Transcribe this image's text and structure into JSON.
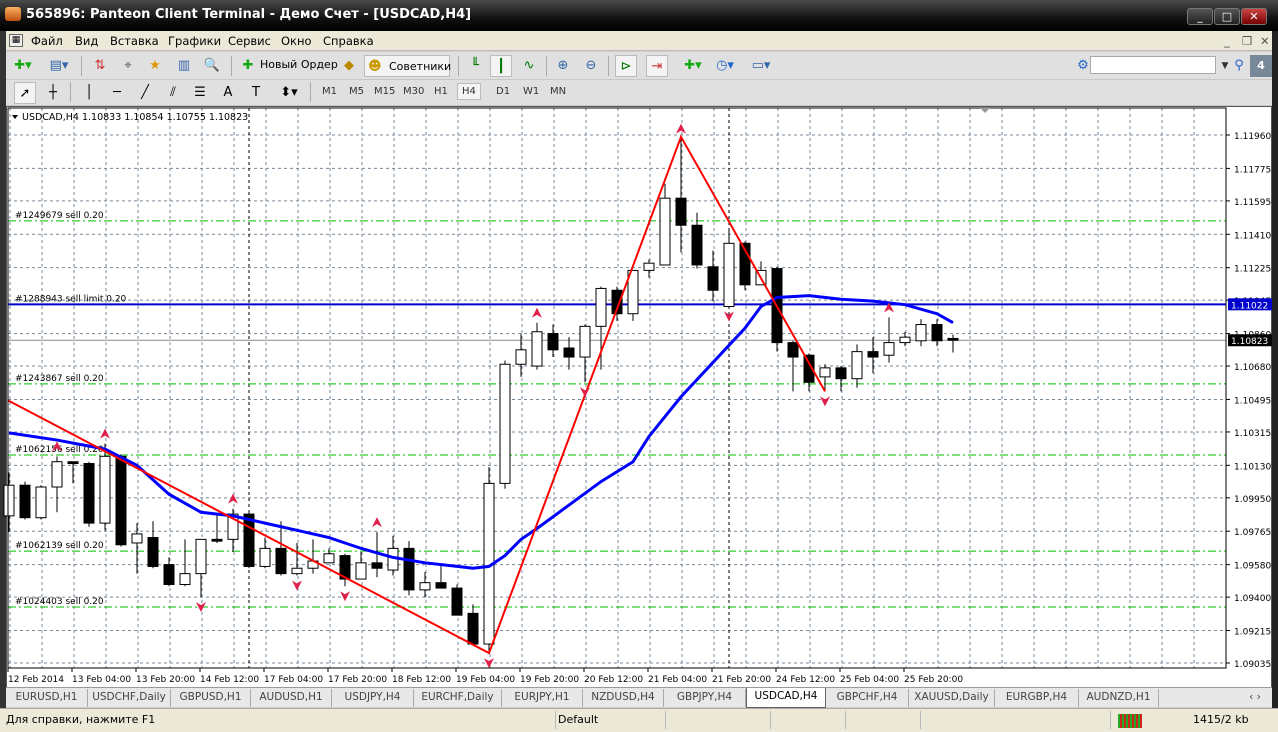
{
  "window": {
    "title": "565896: Panteon Client Terminal - Демо Счет - [USDCAD,H4]",
    "min": "_",
    "max": "□",
    "close": "✕"
  },
  "menu": [
    "Файл",
    "Вид",
    "Вставка",
    "Графики",
    "Сервис",
    "Окно",
    "Справка"
  ],
  "toolbar": {
    "new_order": "Новый Ордер",
    "experts": "Советники",
    "notifications": "4",
    "search_value": ""
  },
  "timeframes": [
    "M1",
    "M5",
    "M15",
    "M30",
    "H1",
    "H4",
    "D1",
    "W1",
    "MN"
  ],
  "active_timeframe": "H4",
  "chart": {
    "header": "USDCAD,H4  1.10833 1.10854 1.10755 1.10823",
    "current_price": "1.10823",
    "pending_price": "1.11022",
    "colors": {
      "ma": "#0000ff",
      "zigzag": "#ff0000",
      "orders": "#00c000",
      "pending": "#0000cc",
      "arrows": "#e0204a"
    },
    "price_ticks": [
      "1.11960",
      "1.11775",
      "1.11595",
      "1.11410",
      "1.11225",
      "1.11045",
      "1.10860",
      "1.10680",
      "1.10495",
      "1.10315",
      "1.10130",
      "1.09950",
      "1.09765",
      "1.09580",
      "1.09400",
      "1.09215",
      "1.09035"
    ],
    "time_labels": [
      "12 Feb 2014",
      "13 Feb 04:00",
      "13 Feb 20:00",
      "14 Feb 12:00",
      "17 Feb 04:00",
      "17 Feb 20:00",
      "18 Feb 12:00",
      "19 Feb 04:00",
      "19 Feb 20:00",
      "20 Feb 12:00",
      "21 Feb 04:00",
      "21 Feb 20:00",
      "24 Feb 12:00",
      "25 Feb 04:00",
      "25 Feb 20:00"
    ],
    "orders": [
      {
        "label": "#1249679 sell 0.20",
        "price": 1.11484,
        "type": "sell"
      },
      {
        "label": "#1288943 sell limit 0.20",
        "price": 1.11022,
        "type": "pending"
      },
      {
        "label": "#1243867 sell 0.20",
        "price": 1.10581,
        "type": "sell"
      },
      {
        "label": "#1062156 sell 0.20",
        "price": 1.10187,
        "type": "sell"
      },
      {
        "label": "#1062139 sell 0.20",
        "price": 1.09655,
        "type": "sell"
      },
      {
        "label": "#1024403 sell 0.20",
        "price": 1.09345,
        "type": "sell"
      }
    ]
  },
  "chart_data": {
    "type": "candlestick",
    "symbol": "USDCAD",
    "timeframe": "H4",
    "ylim": [
      1.09035,
      1.1196
    ],
    "ohlc": [
      [
        1.0985,
        1.1009,
        1.0976,
        1.1002
      ],
      [
        1.1002,
        1.1004,
        1.0983,
        1.0984
      ],
      [
        1.0984,
        1.1002,
        1.0983,
        1.1001
      ],
      [
        1.1001,
        1.1018,
        1.0987,
        1.1015
      ],
      [
        1.1015,
        1.1015,
        1.1003,
        1.1014
      ],
      [
        1.1014,
        1.1015,
        1.0979,
        1.0981
      ],
      [
        1.0981,
        1.1025,
        1.0977,
        1.1018
      ],
      [
        1.1018,
        1.1019,
        1.0968,
        1.0969
      ],
      [
        1.097,
        1.0981,
        1.0953,
        1.0975
      ],
      [
        1.0973,
        1.0982,
        1.0956,
        1.0957
      ],
      [
        1.0958,
        1.0962,
        1.0946,
        1.0947
      ],
      [
        1.0947,
        1.0972,
        1.0946,
        1.0953
      ],
      [
        1.0953,
        1.0972,
        1.094,
        1.0972
      ],
      [
        1.0972,
        1.0986,
        1.097,
        1.0971
      ],
      [
        1.0972,
        1.0989,
        1.0965,
        1.0986
      ],
      [
        1.0986,
        1.0988,
        1.0956,
        1.0957
      ],
      [
        1.0957,
        1.0973,
        1.0956,
        1.0967
      ],
      [
        1.0967,
        1.0982,
        1.0952,
        1.0953
      ],
      [
        1.0953,
        1.097,
        1.0952,
        1.0956
      ],
      [
        1.0956,
        1.0972,
        1.0953,
        1.096
      ],
      [
        1.0959,
        1.0967,
        1.0959,
        1.0964
      ],
      [
        1.0963,
        1.0964,
        1.0946,
        1.095
      ],
      [
        1.095,
        1.0965,
        1.095,
        1.0959
      ],
      [
        1.0959,
        1.0976,
        1.0951,
        1.0956
      ],
      [
        1.0955,
        1.0974,
        1.0952,
        1.0967
      ],
      [
        1.0967,
        1.0971,
        1.0941,
        1.0944
      ],
      [
        1.0944,
        1.0954,
        1.094,
        1.0948
      ],
      [
        1.0948,
        1.0958,
        1.0945,
        1.0945
      ],
      [
        1.0945,
        1.0947,
        1.093,
        1.093
      ],
      [
        1.0931,
        1.0936,
        1.0914,
        1.0914
      ],
      [
        1.0914,
        1.1012,
        1.0909,
        1.1003
      ],
      [
        1.1003,
        1.1071,
        1.1,
        1.1069
      ],
      [
        1.1069,
        1.1086,
        1.1062,
        1.1077
      ],
      [
        1.1068,
        1.1092,
        1.1066,
        1.1087
      ],
      [
        1.1086,
        1.1091,
        1.1073,
        1.1077
      ],
      [
        1.1078,
        1.1084,
        1.1066,
        1.1073
      ],
      [
        1.1073,
        1.1091,
        1.1059,
        1.109
      ],
      [
        1.109,
        1.1112,
        1.1066,
        1.1111
      ],
      [
        1.111,
        1.1112,
        1.1093,
        1.1097
      ],
      [
        1.1097,
        1.1121,
        1.1093,
        1.1121
      ],
      [
        1.1121,
        1.1127,
        1.1117,
        1.1125
      ],
      [
        1.1124,
        1.1169,
        1.1124,
        1.1161
      ],
      [
        1.1161,
        1.1194,
        1.1131,
        1.1146
      ],
      [
        1.1146,
        1.1153,
        1.1122,
        1.1124
      ],
      [
        1.1123,
        1.1132,
        1.1104,
        1.111
      ],
      [
        1.1101,
        1.1144,
        1.1101,
        1.1136
      ],
      [
        1.1136,
        1.1137,
        1.111,
        1.1113
      ],
      [
        1.1113,
        1.1126,
        1.1113,
        1.1121
      ],
      [
        1.1122,
        1.1123,
        1.1076,
        1.1081
      ],
      [
        1.1081,
        1.1082,
        1.1054,
        1.1073
      ],
      [
        1.1074,
        1.1075,
        1.1054,
        1.1059
      ],
      [
        1.1062,
        1.1069,
        1.1054,
        1.1067
      ],
      [
        1.1067,
        1.1068,
        1.1054,
        1.1061
      ],
      [
        1.1061,
        1.108,
        1.1056,
        1.1076
      ],
      [
        1.1076,
        1.1084,
        1.1064,
        1.1073
      ],
      [
        1.1074,
        1.1095,
        1.107,
        1.1081
      ],
      [
        1.1081,
        1.1087,
        1.1079,
        1.1084
      ],
      [
        1.1082,
        1.1094,
        1.1079,
        1.1091
      ],
      [
        1.1091,
        1.1094,
        1.1079,
        1.1082
      ],
      [
        1.10833,
        1.10854,
        1.10755,
        1.10823
      ]
    ],
    "moving_average": [
      [
        0,
        1.1031
      ],
      [
        3,
        1.1027
      ],
      [
        6,
        1.1022
      ],
      [
        8,
        1.1013
      ],
      [
        10,
        1.0997
      ],
      [
        12,
        1.0987
      ],
      [
        14,
        1.0985
      ],
      [
        16,
        1.0981
      ],
      [
        18,
        1.0977
      ],
      [
        20,
        1.0973
      ],
      [
        22,
        1.0967
      ],
      [
        24,
        1.0962
      ],
      [
        26,
        1.0959
      ],
      [
        28,
        1.0957
      ],
      [
        29,
        1.0956
      ],
      [
        30,
        1.0957
      ],
      [
        31,
        1.0963
      ],
      [
        32,
        1.0972
      ],
      [
        33,
        1.0978
      ],
      [
        35,
        1.0991
      ],
      [
        37,
        1.1004
      ],
      [
        39,
        1.1015
      ],
      [
        40,
        1.1029
      ],
      [
        42,
        1.1051
      ],
      [
        44,
        1.107
      ],
      [
        46,
        1.1089
      ],
      [
        47,
        1.1101
      ],
      [
        48,
        1.1106
      ],
      [
        50,
        1.1107
      ],
      [
        52,
        1.1105
      ],
      [
        54,
        1.1104
      ],
      [
        56,
        1.1102
      ],
      [
        58,
        1.1097
      ],
      [
        59,
        1.1092
      ]
    ],
    "zigzag": [
      [
        -0.1,
        1.1049
      ],
      [
        30,
        1.0909
      ],
      [
        42,
        1.1195
      ],
      [
        51,
        1.1054
      ]
    ],
    "fractals_up": [
      3,
      6,
      14,
      23,
      33,
      42,
      55
    ],
    "fractals_down": [
      12,
      18,
      21,
      30,
      36,
      45,
      51
    ],
    "period_separators": [
      15,
      45
    ]
  },
  "tabs": [
    "EURUSD,H1",
    "USDCHF,Daily",
    "GBPUSD,H1",
    "AUDUSD,H1",
    "USDJPY,H4",
    "EURCHF,Daily",
    "EURJPY,H1",
    "NZDUSD,H4",
    "GBPJPY,H4",
    "USDCAD,H4",
    "GBPCHF,H4",
    "XAUUSD,Daily",
    "EURGBP,H4",
    "AUDNZD,H1"
  ],
  "active_tab": "USDCAD,H4",
  "status": {
    "help": "Для справки, нажмите F1",
    "profile": "Default",
    "traffic": "1415/2 kb"
  }
}
